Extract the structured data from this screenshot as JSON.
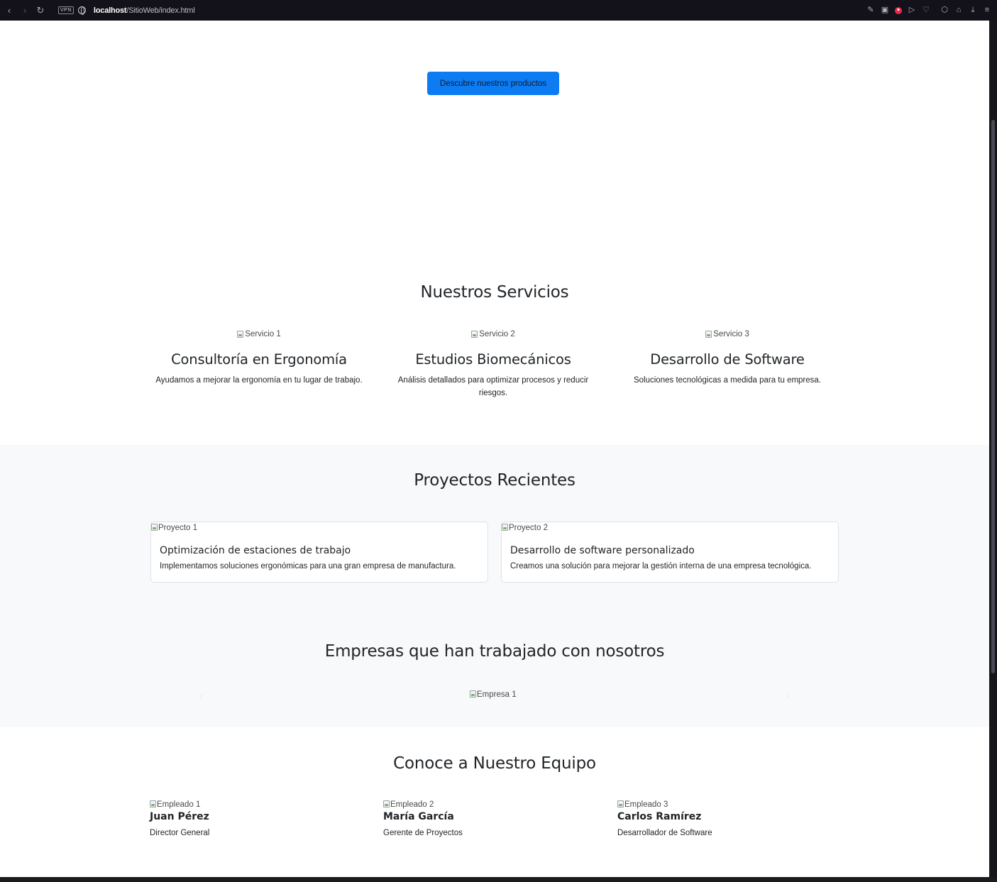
{
  "browser": {
    "url_host": "localhost",
    "url_path": "/SitioWeb/index.html",
    "vpn_label": "VPN"
  },
  "hero": {
    "cta_label": "Descubre nuestros productos"
  },
  "services": {
    "title": "Nuestros Servicios",
    "items": [
      {
        "img_alt": "Servicio 1",
        "title": "Consultoría en Ergonomía",
        "desc": "Ayudamos a mejorar la ergonomía en tu lugar de trabajo."
      },
      {
        "img_alt": "Servicio 2",
        "title": "Estudios Biomecánicos",
        "desc": "Análisis detallados para optimizar procesos y reducir riesgos."
      },
      {
        "img_alt": "Servicio 3",
        "title": "Desarrollo de Software",
        "desc": "Soluciones tecnológicas a medida para tu empresa."
      }
    ]
  },
  "projects": {
    "title": "Proyectos Recientes",
    "items": [
      {
        "img_alt": "Proyecto 1",
        "title": "Optimización de estaciones de trabajo",
        "desc": "Implementamos soluciones ergonómicas para una gran empresa de manufactura."
      },
      {
        "img_alt": "Proyecto 2",
        "title": "Desarrollo de software personalizado",
        "desc": "Creamos una solución para mejorar la gestión interna de una empresa tecnológica."
      }
    ]
  },
  "clients": {
    "title": "Empresas que han trabajado con nosotros",
    "slide_img_alt": "Empresa 1",
    "prev_icon": "chevron-left-icon",
    "next_icon": "chevron-right-icon"
  },
  "team": {
    "title": "Conoce a Nuestro Equipo",
    "members": [
      {
        "img_alt": "Empleado 1",
        "name": "Juan Pérez",
        "role": "Director General"
      },
      {
        "img_alt": "Empleado 2",
        "name": "María García",
        "role": "Gerente de Proyectos"
      },
      {
        "img_alt": "Empleado 3",
        "name": "Carlos Ramírez",
        "role": "Desarrollador de Software"
      }
    ]
  },
  "colors": {
    "primary": "#0d7cf2",
    "light_band": "#f8f9fa",
    "browser_bar": "#13121a"
  }
}
